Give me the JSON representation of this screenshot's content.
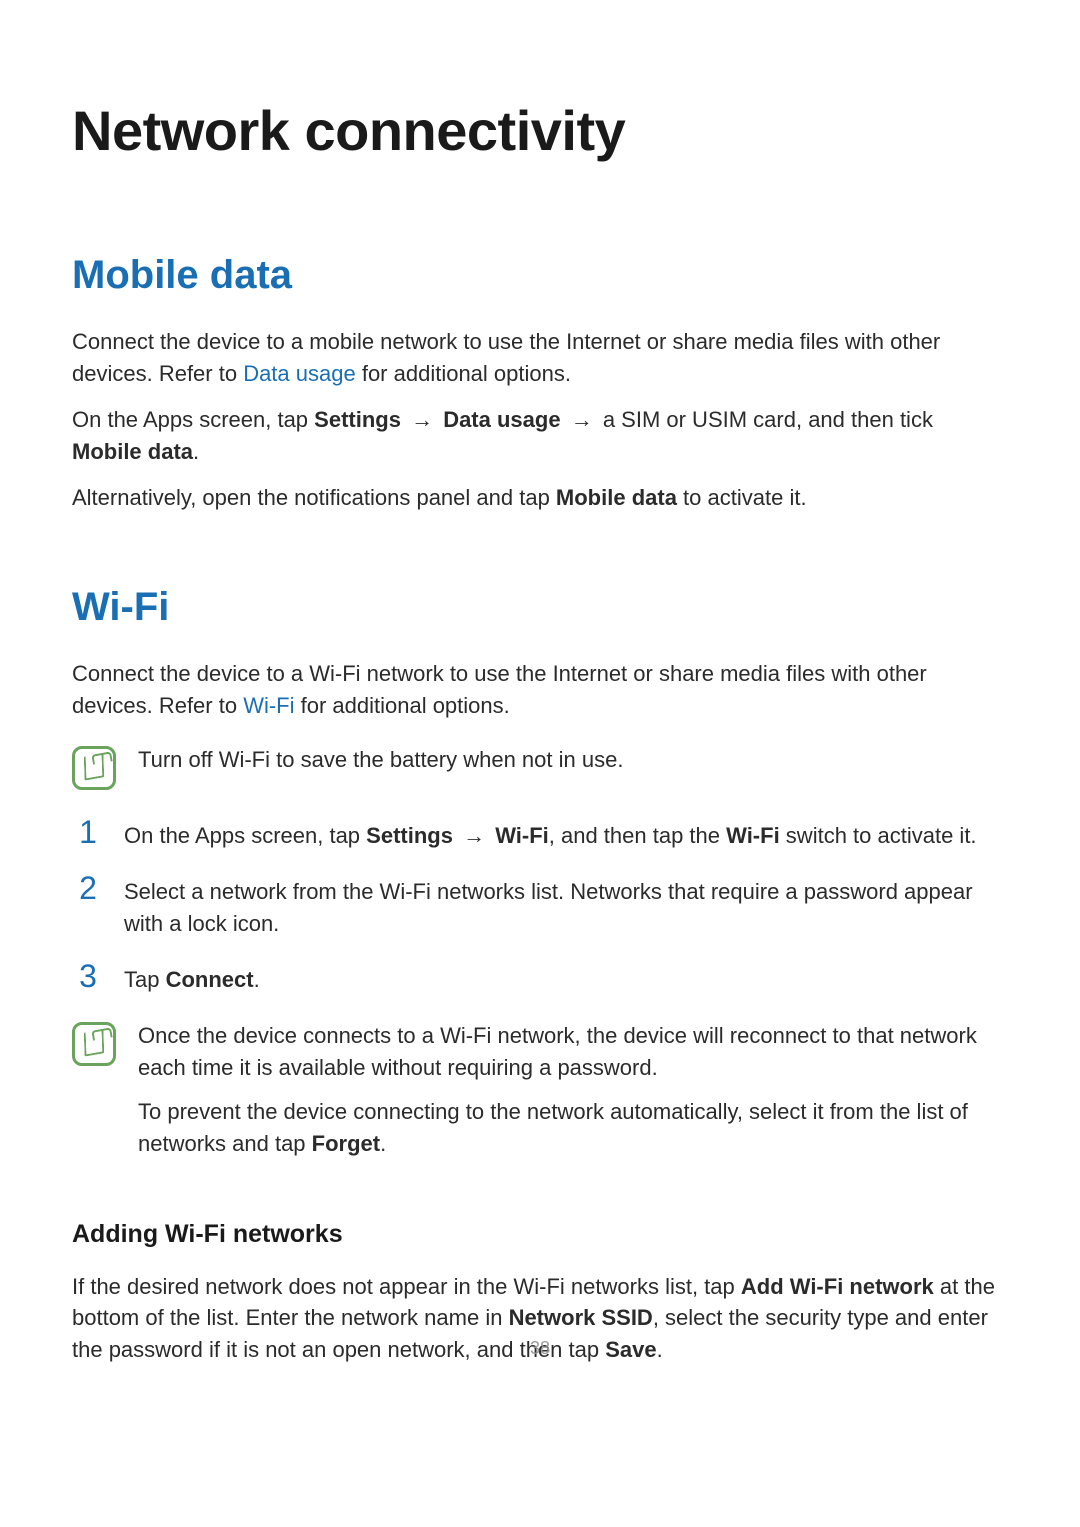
{
  "page_number": "38",
  "title": "Network connectivity",
  "mobile_data": {
    "heading": "Mobile data",
    "p1_pre": "Connect the device to a mobile network to use the Internet or share media files with other devices. Refer to ",
    "p1_link": "Data usage",
    "p1_post": " for additional options.",
    "p2_a": "On the Apps screen, tap ",
    "p2_b1": "Settings",
    "p2_arrow": " → ",
    "p2_b2": "Data usage",
    "p2_c": " a SIM or USIM card, and then tick ",
    "p2_b3": "Mobile data",
    "p2_d": ".",
    "p3_a": "Alternatively, open the notifications panel and tap ",
    "p3_b": "Mobile data",
    "p3_c": " to activate it."
  },
  "wifi": {
    "heading": "Wi-Fi",
    "p1_pre": "Connect the device to a Wi-Fi network to use the Internet or share media files with other devices. Refer to ",
    "p1_link": "Wi-Fi",
    "p1_post": " for additional options.",
    "note1": "Turn off Wi-Fi to save the battery when not in use.",
    "steps": {
      "n1": "1",
      "s1_a": "On the Apps screen, tap ",
      "s1_b1": "Settings",
      "s1_arrow": " → ",
      "s1_b2": "Wi-Fi",
      "s1_c": ", and then tap the ",
      "s1_b3": "Wi-Fi",
      "s1_d": " switch to activate it.",
      "n2": "2",
      "s2": "Select a network from the Wi-Fi networks list. Networks that require a password appear with a lock icon.",
      "n3": "3",
      "s3_a": "Tap ",
      "s3_b": "Connect",
      "s3_c": "."
    },
    "note2_p1": "Once the device connects to a Wi-Fi network, the device will reconnect to that network each time it is available without requiring a password.",
    "note2_p2_a": "To prevent the device connecting to the network automatically, select it from the list of networks and tap ",
    "note2_p2_b": "Forget",
    "note2_p2_c": ".",
    "adding_heading": "Adding Wi-Fi networks",
    "adding_p_a": "If the desired network does not appear in the Wi-Fi networks list, tap ",
    "adding_b1": "Add Wi-Fi network",
    "adding_p_b": " at the bottom of the list. Enter the network name in ",
    "adding_b2": "Network SSID",
    "adding_p_c": ", select the security type and enter the password if it is not an open network, and then tap ",
    "adding_b3": "Save",
    "adding_p_d": "."
  }
}
